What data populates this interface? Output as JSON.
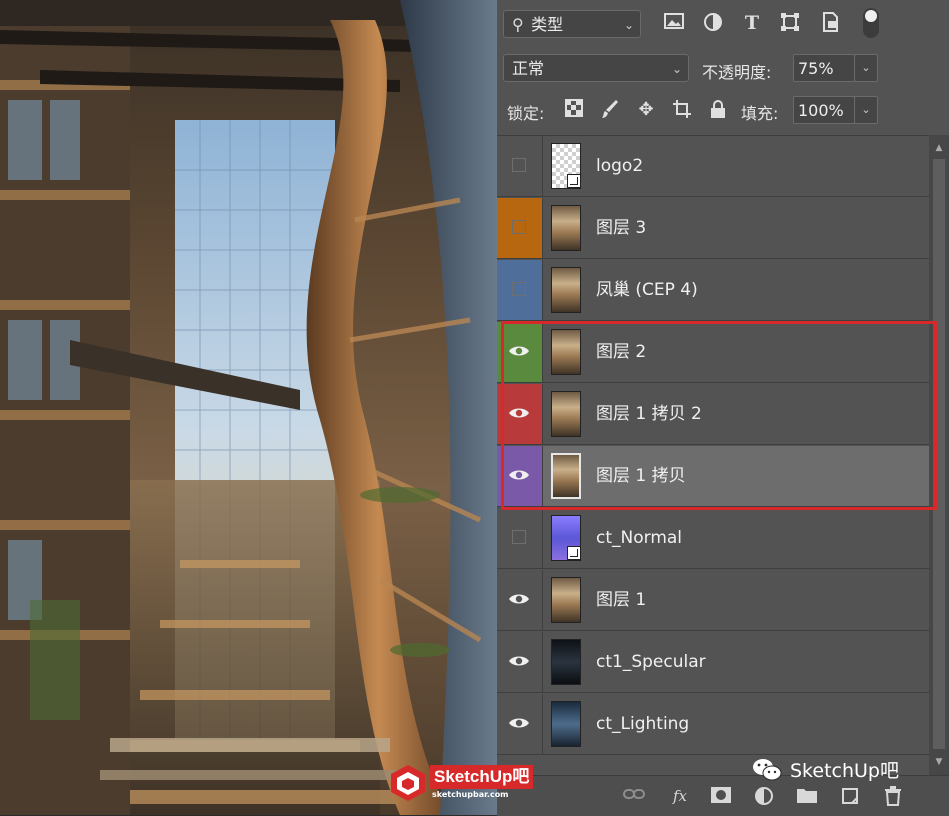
{
  "panel": {
    "filter_label": "类型",
    "blend_mode": "正常",
    "opacity_label": "不透明度:",
    "opacity_value": "75%",
    "lock_label": "锁定:",
    "fill_label": "填充:",
    "fill_value": "100%",
    "layers": [
      {
        "name": "logo2",
        "visible": false,
        "color": "",
        "thumb": "transparent",
        "smart": true
      },
      {
        "name": "图层 3",
        "visible": false,
        "color": "#b7670f",
        "thumb": "photo",
        "smart": false
      },
      {
        "name": "凤巢 (CEP 4)",
        "visible": false,
        "color": "#4f6f9a",
        "thumb": "photo",
        "smart": false
      },
      {
        "name": "图层 2",
        "visible": true,
        "color": "#5a8a3d",
        "thumb": "photo",
        "smart": false
      },
      {
        "name": "图层 1 拷贝 2",
        "visible": true,
        "color": "#b93a3a",
        "thumb": "photo",
        "smart": false
      },
      {
        "name": "图层 1 拷贝",
        "visible": true,
        "color": "#7a5aa8",
        "thumb": "photo",
        "smart": false,
        "selected": true
      },
      {
        "name": "ct_Normal",
        "visible": false,
        "color": "",
        "thumb": "normal",
        "smart": true
      },
      {
        "name": "图层 1",
        "visible": true,
        "color": "",
        "thumb": "photo",
        "smart": false
      },
      {
        "name": "ct1_Specular",
        "visible": true,
        "color": "",
        "thumb": "dark",
        "smart": false
      },
      {
        "name": "ct_Lighting",
        "visible": true,
        "color": "",
        "thumb": "darkblue",
        "smart": false
      }
    ]
  },
  "watermark": {
    "brand": "SketchUp吧",
    "url": "sketchupbar.com",
    "wechat": "SketchUp吧"
  },
  "colors": {
    "highlight": "#d8292a",
    "panel_bg": "#535353"
  }
}
